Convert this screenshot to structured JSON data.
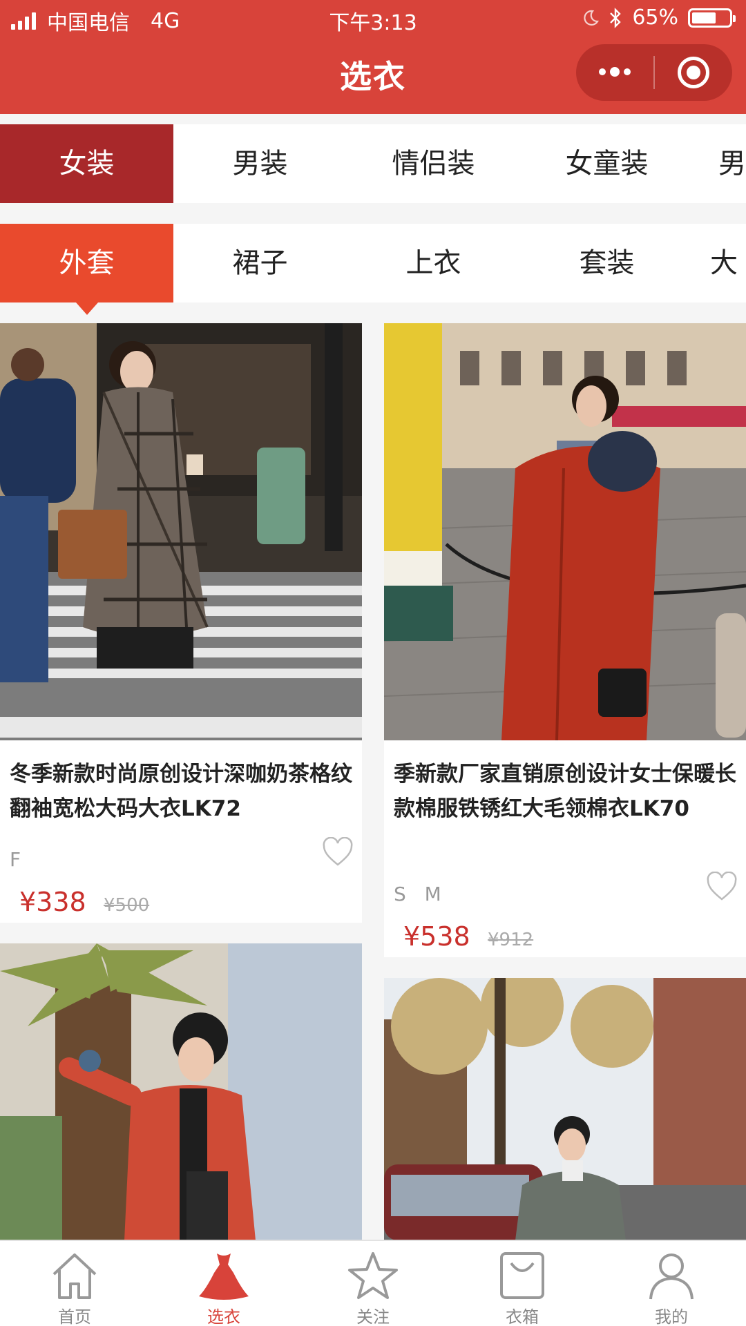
{
  "status_bar": {
    "carrier": "中国电信",
    "network": "4G",
    "time": "下午3:13",
    "battery": "65%",
    "battery_level": 0.65
  },
  "nav": {
    "title": "选衣"
  },
  "category_tabs": [
    {
      "label": "女装",
      "active": true
    },
    {
      "label": "男装",
      "active": false
    },
    {
      "label": "情侣装",
      "active": false
    },
    {
      "label": "女童装",
      "active": false
    },
    {
      "label": "男",
      "active": false
    }
  ],
  "sub_tabs": [
    {
      "label": "外套",
      "active": true
    },
    {
      "label": "裙子",
      "active": false
    },
    {
      "label": "上衣",
      "active": false
    },
    {
      "label": "套装",
      "active": false
    },
    {
      "label": "大",
      "active": false
    }
  ],
  "products": [
    {
      "title": "冬季新款时尚原创设计深咖奶茶格纹翻袖宽松大码大衣LK72",
      "sizes": "F",
      "price": "¥338",
      "original_price": "¥500"
    },
    {
      "title": "季新款厂家直销原创设计女士保暖长款棉服铁锈红大毛领棉衣LK70",
      "sizes": "S M",
      "price": "¥538",
      "original_price": "¥912"
    }
  ],
  "tabbar": [
    {
      "label": "首页",
      "icon": "home-icon",
      "active": false
    },
    {
      "label": "选衣",
      "icon": "dress-icon",
      "active": true
    },
    {
      "label": "关注",
      "icon": "star-icon",
      "active": false
    },
    {
      "label": "衣箱",
      "icon": "bag-icon",
      "active": false
    },
    {
      "label": "我的",
      "icon": "user-icon",
      "active": false
    }
  ],
  "colors": {
    "brand_red": "#d8433a",
    "category_active": "#a8282a",
    "sub_active": "#e94a2d",
    "price_red": "#c9302c"
  }
}
